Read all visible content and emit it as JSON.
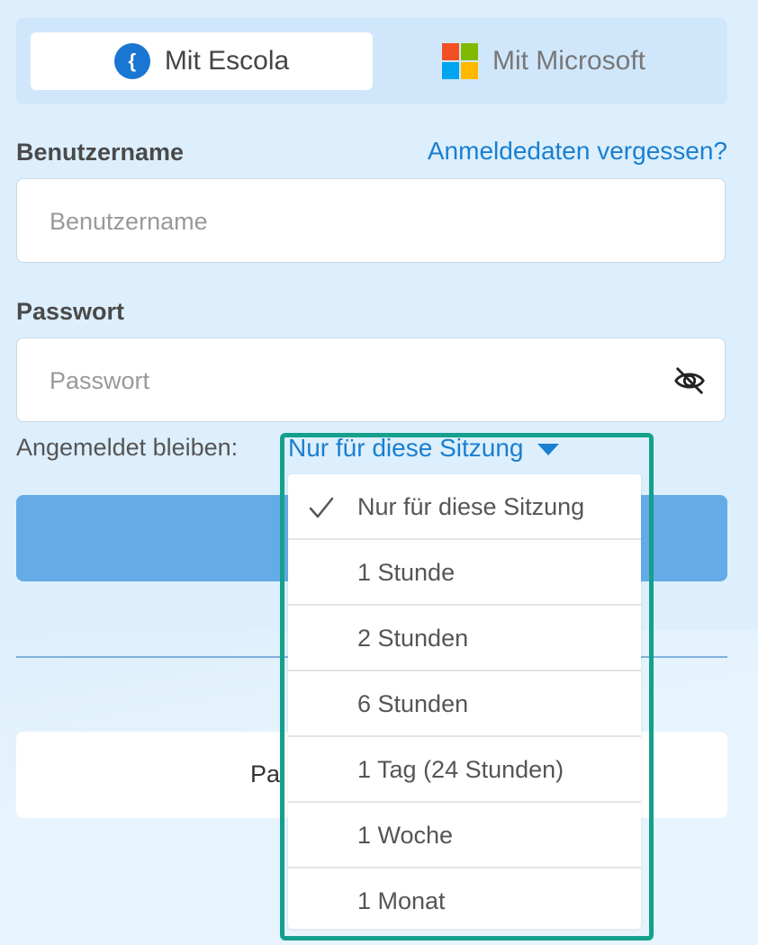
{
  "login_methods": {
    "escola_label": "Mit Escola",
    "microsoft_label": "Mit Microsoft"
  },
  "username": {
    "label": "Benutzername",
    "placeholder": "Benutzername",
    "forgot_link": "Anmeldedaten vergessen?"
  },
  "password": {
    "label": "Passwort",
    "placeholder": "Passwort"
  },
  "stay_logged_in": {
    "label": "Angemeldet bleiben:",
    "selected": "Nur für diese Sitzung",
    "options": [
      "Nur für diese Sitzung",
      "1 Stunde",
      "2 Stunden",
      "6 Stunden",
      "1 Tag (24 Stunden)",
      "1 Woche",
      "1 Monat"
    ]
  },
  "secondary_button_partial": "Pa",
  "icons": {
    "escola": "escola-logo-icon",
    "microsoft": "microsoft-logo-icon",
    "password_visibility": "eye-off-icon",
    "dropdown_caret": "caret-down-icon",
    "selected_check": "check-icon"
  },
  "colors": {
    "accent": "#1a7fd0",
    "primary_button": "#64abe7",
    "dropdown_highlight": "#14a08c",
    "background": "#ddeffc"
  }
}
